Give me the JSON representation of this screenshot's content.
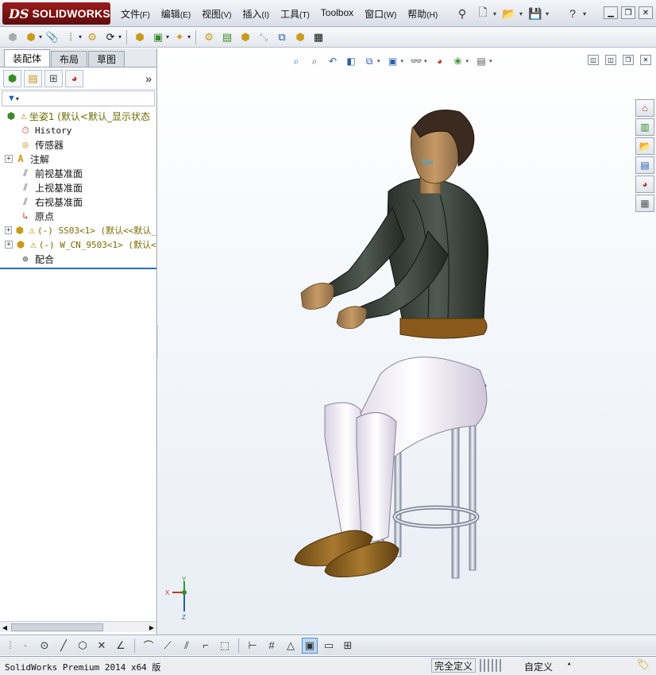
{
  "app": {
    "logo_ds": "DS",
    "logo_text": "SOLIDWORKS"
  },
  "menu": {
    "items": [
      {
        "label": "文件",
        "accel": "(F)"
      },
      {
        "label": "编辑",
        "accel": "(E)"
      },
      {
        "label": "视图",
        "accel": "(V)"
      },
      {
        "label": "插入",
        "accel": "(I)"
      },
      {
        "label": "工具",
        "accel": "(T)"
      },
      {
        "label": "Toolbox",
        "accel": ""
      },
      {
        "label": "窗口",
        "accel": "(W)"
      },
      {
        "label": "帮助",
        "accel": "(H)"
      }
    ]
  },
  "left_pane": {
    "tabs": [
      "装配体",
      "布局",
      "草图"
    ],
    "active_tab": "装配体",
    "more_glyph": "»",
    "tree": [
      {
        "expand": "",
        "icon": "assembly-icon",
        "warn": true,
        "label": "坐姿1  (默认<默认_显示状态",
        "style": "olive"
      },
      {
        "expand": "",
        "icon": "history-icon",
        "warn": false,
        "label": "History",
        "style": "mono-plain"
      },
      {
        "expand": "",
        "icon": "sensor-icon",
        "warn": false,
        "label": "传感器",
        "style": "plain"
      },
      {
        "expand": "+",
        "icon": "annotation-icon",
        "warn": false,
        "label": "注解",
        "style": "plain"
      },
      {
        "expand": "",
        "icon": "plane-icon",
        "warn": false,
        "label": "前视基准面",
        "style": "plain"
      },
      {
        "expand": "",
        "icon": "plane-icon",
        "warn": false,
        "label": "上视基准面",
        "style": "plain"
      },
      {
        "expand": "",
        "icon": "plane-icon",
        "warn": false,
        "label": "右视基准面",
        "style": "plain"
      },
      {
        "expand": "",
        "icon": "origin-icon",
        "warn": false,
        "label": "原点",
        "style": "plain"
      },
      {
        "expand": "+",
        "icon": "subassembly-icon",
        "warn": true,
        "label": "(-) SS03<1> (默认<<默认_",
        "style": "mono"
      },
      {
        "expand": "+",
        "icon": "subassembly-icon",
        "warn": true,
        "label": "(-) W_CN_9503<1> (默认<",
        "style": "mono"
      },
      {
        "expand": "",
        "icon": "mates-icon",
        "warn": false,
        "label": "配合",
        "style": "plain"
      }
    ]
  },
  "colors": {
    "logo_red": "#9c1b1b",
    "selection_blue": "#2d6cc0",
    "warning_yellow": "#e0b000"
  },
  "triad": {
    "x": "X",
    "y": "Y",
    "z": "Z"
  },
  "status": {
    "product": "SolidWorks Premium 2014 x64 版",
    "defined": "完全定义",
    "units": "自定义",
    "units_caret": "▴"
  }
}
